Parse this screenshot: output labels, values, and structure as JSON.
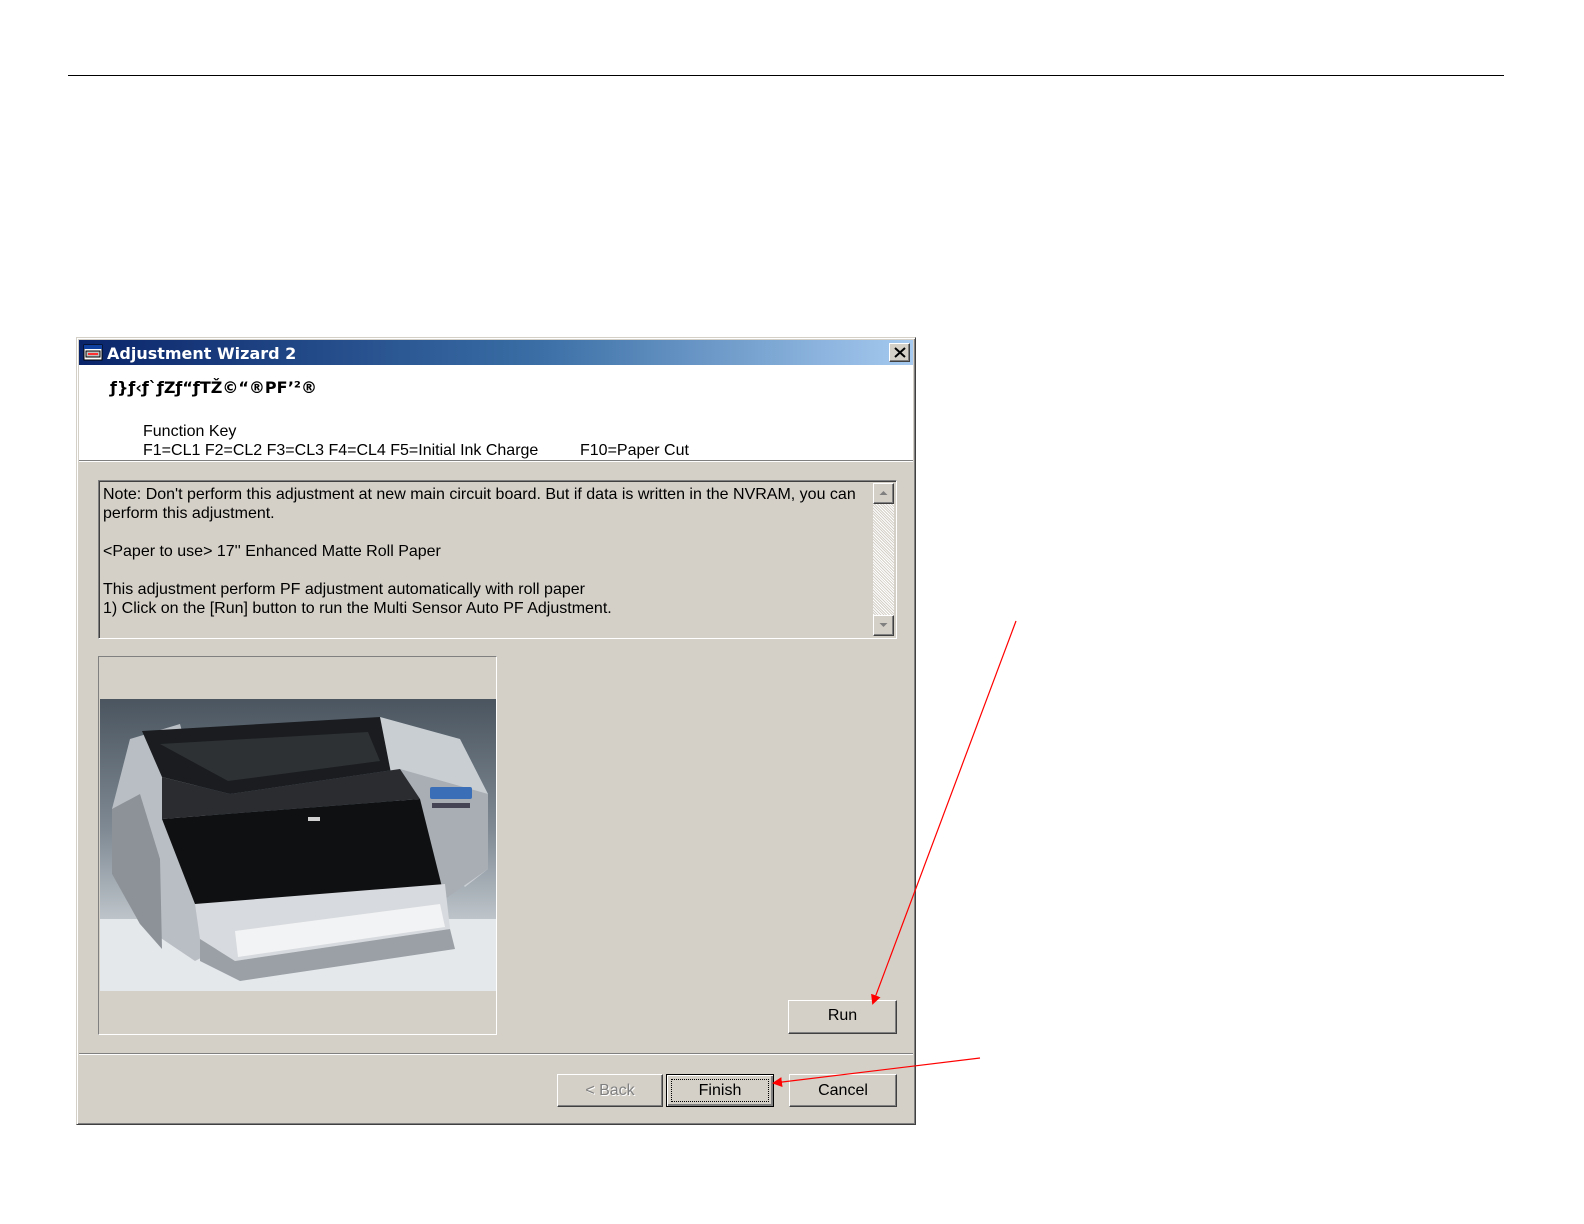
{
  "window": {
    "title": "Adjustment Wizard 2"
  },
  "header": {
    "title": "ƒ}ƒ‹ƒ`ƒZƒ“ƒTŽ©“®PF’²®",
    "function_key_label": "Function Key",
    "function_keys": "F1=CL1  F2=CL2  F3=CL3  F4=CL4  F5=Initial Ink Charge",
    "function_keys_extra": "F10=Paper Cut"
  },
  "note": {
    "line1": "Note: Don't perform this adjustment at new main circuit board. But if data is written in the NVRAM, you can",
    "line2": "perform this adjustment.",
    "line3": "<Paper to use>  17'' Enhanced Matte Roll Paper",
    "line4": "This adjustment perform PF adjustment automatically with roll paper",
    "line5": "1) Click on the [Run] button to run the Multi Sensor Auto PF Adjustment."
  },
  "buttons": {
    "run": "Run",
    "back": "< Back",
    "finish": "Finish",
    "cancel": "Cancel"
  },
  "colors": {
    "titlebar_start": "#0a246a",
    "titlebar_end": "#a6caf0",
    "dialog_face": "#d4d0c8",
    "annotation_arrow": "#ff0000"
  },
  "icons": {
    "title": "printer-window-icon",
    "close": "close-icon",
    "scroll_up": "arrow-up-icon",
    "scroll_down": "arrow-down-icon"
  }
}
